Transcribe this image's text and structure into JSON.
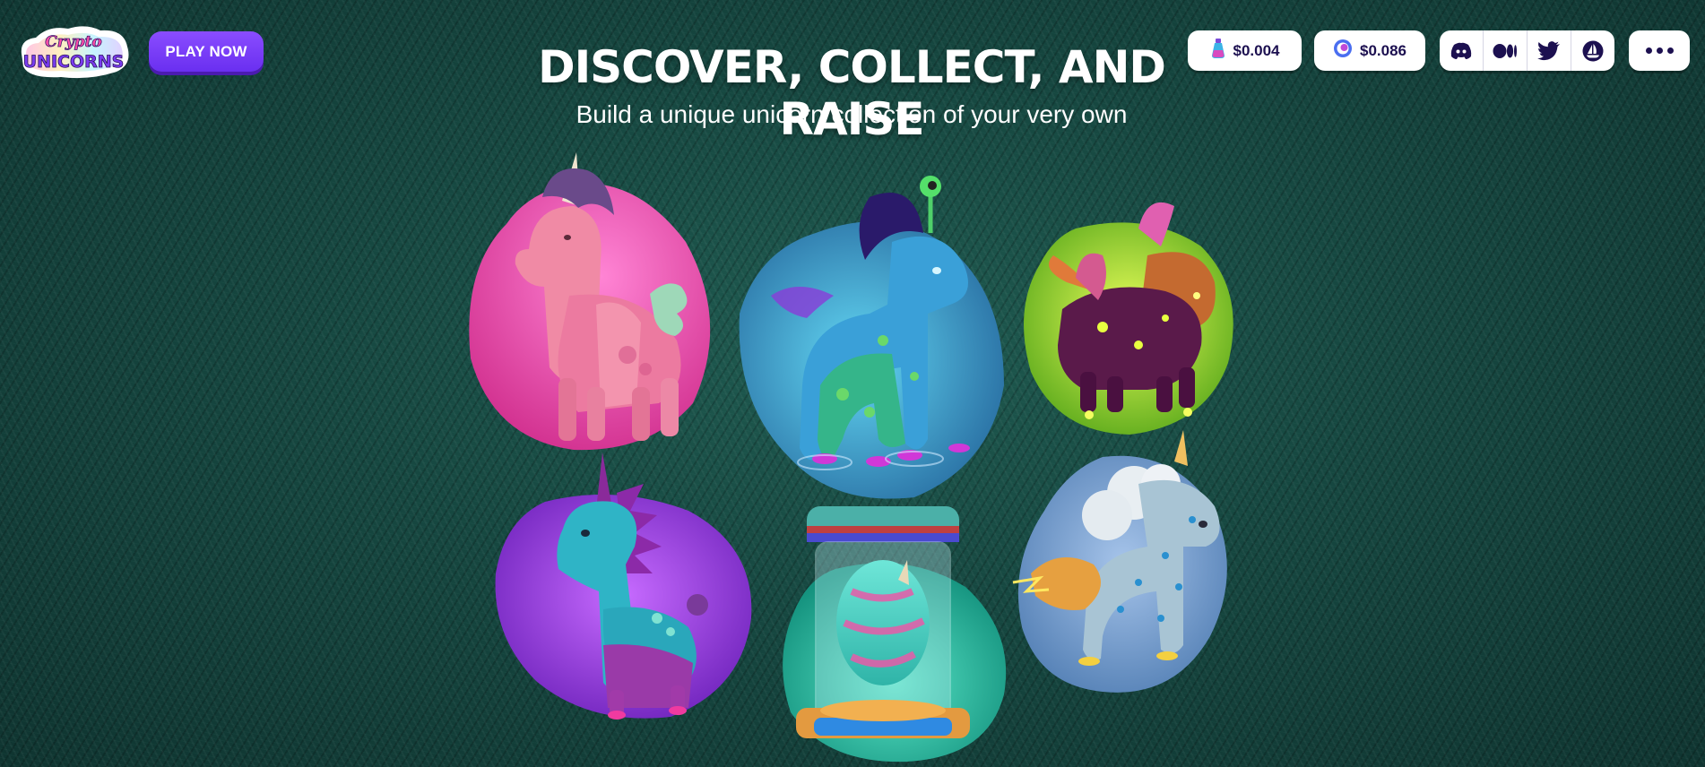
{
  "header": {
    "logo": {
      "line1": "Crypto",
      "line2": "UNICORNS"
    },
    "play_button": "PLAY NOW",
    "prices": [
      {
        "icon": "potion-token-icon",
        "value": "$0.004"
      },
      {
        "icon": "token-coin-icon",
        "value": "$0.086"
      }
    ],
    "socials": [
      "discord-icon",
      "medium-icon",
      "twitter-icon",
      "opensea-icon"
    ],
    "more_icon": "more-icon"
  },
  "hero": {
    "title": "DISCOVER, COLLECT, AND RAISE",
    "subtitle": "Build a unique unicorn collection of your very own"
  },
  "gallery": [
    {
      "name": "pink-unicorn",
      "blob_color": "#d63a96"
    },
    {
      "name": "blue-cosmic-unicorn",
      "blob_color": "#2d7fb8"
    },
    {
      "name": "glowing-yellow-unicorn",
      "blob_color": "#8ed21e"
    },
    {
      "name": "purple-spiky-unicorn",
      "blob_color": "#8a2ad8"
    },
    {
      "name": "unicorn-egg-incubator",
      "blob_color": "#1fb8a2"
    },
    {
      "name": "cloud-storm-unicorn",
      "blob_color": "#6a93c4"
    }
  ],
  "colors": {
    "primary": "#7b3ff7",
    "grass": "#164740",
    "text_dark": "#1c1050"
  }
}
